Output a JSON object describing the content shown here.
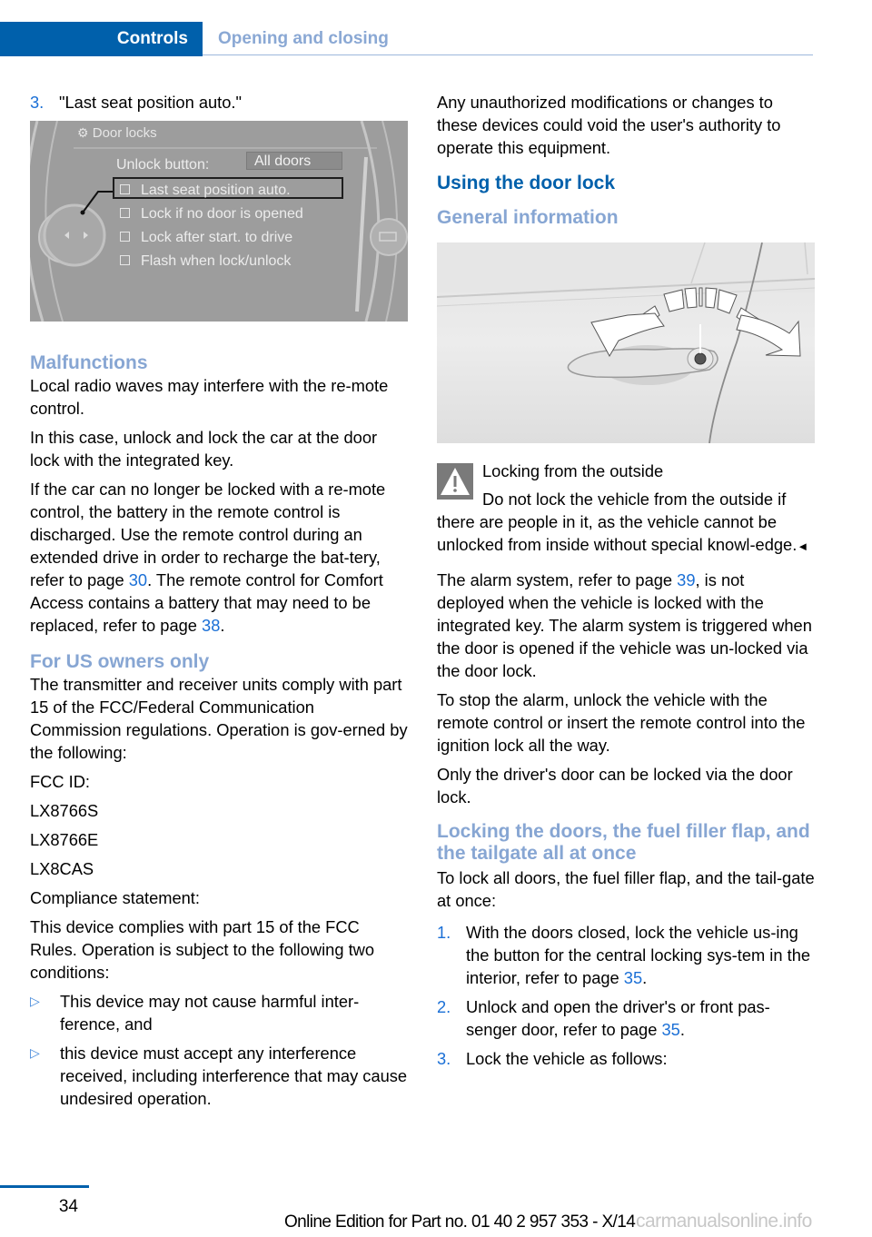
{
  "header": {
    "section": "Controls",
    "subsection": "Opening and closing"
  },
  "left": {
    "step3": {
      "num": "3.",
      "text": "\"Last seat position auto.\""
    },
    "screen": {
      "title": "Door locks",
      "unlock_label": "Unlock button:",
      "unlock_value": "All doors",
      "options": [
        {
          "label": "Last seat position auto.",
          "checked": false,
          "selected": true
        },
        {
          "label": "Lock if no door is opened",
          "checked": false,
          "selected": false
        },
        {
          "label": "Lock after start. to drive",
          "checked": false,
          "selected": false
        },
        {
          "label": "Flash when lock/unlock",
          "checked": false,
          "selected": false
        }
      ]
    },
    "malfunctions": {
      "heading": "Malfunctions",
      "p1": "Local radio waves may interfere with the re-mote control.",
      "p2": "In this case, unlock and lock the car at the door lock with the integrated key.",
      "p3a": "If the car can no longer be locked with a re-mote control, the battery in the remote control is discharged. Use the remote control during an extended drive in order to recharge the bat-tery, refer to page ",
      "p3_link1": "30",
      "p3b": ". The remote control for Comfort Access contains a battery that may need to be replaced, refer to page ",
      "p3_link2": "38",
      "p3c": "."
    },
    "us_owners": {
      "heading": "For US owners only",
      "p1": "The transmitter and receiver units comply with part 15 of the FCC/Federal Communication Commission regulations. Operation is gov-erned by the following:",
      "fcc_label": "FCC ID:",
      "ids": [
        "LX8766S",
        "LX8766E",
        "LX8CAS"
      ],
      "compliance_label": "Compliance statement:",
      "p2": "This device complies with part 15 of the FCC Rules. Operation is subject to the following two conditions:",
      "bullet_glyph": "▷",
      "conditions": [
        "This device may not cause harmful inter-ference, and",
        "this device must accept any interference received, including interference that may cause undesired operation."
      ]
    }
  },
  "right": {
    "p_unauth": "Any unauthorized modifications or changes to these devices could void the user's authority to operate this equipment.",
    "heading_door_lock": "Using the door lock",
    "heading_general": "General information",
    "warning": {
      "title": "Locking from the outside",
      "text": "Do not lock the vehicle from the outside if there are people in it, as the vehicle cannot be unlocked from inside without special knowl-edge.",
      "end_mark": "◄"
    },
    "alarm": {
      "a": "The alarm system, refer to page ",
      "link": "39",
      "b": ", is not deployed when the vehicle is locked with the integrated key. The alarm system is triggered when the door is opened if the vehicle was un-locked via the door lock."
    },
    "stop_alarm": "To stop the alarm, unlock the vehicle with the remote control or insert the remote control into the ignition lock all the way.",
    "driver_only": "Only the driver's door can be locked via the door lock.",
    "heading_lock_all": "Locking the doors, the fuel filler flap, and the tailgate all at once",
    "lock_all_intro": "To lock all doors, the fuel filler flap, and the tail-gate at once:",
    "steps": [
      {
        "num": "1.",
        "text": "With the doors closed, lock the vehicle us-ing the button for the central locking sys-tem in the interior, refer to page ",
        "link": "35",
        "tail": "."
      },
      {
        "num": "2.",
        "text": "Unlock and open the driver's or front pas-senger door, refer to page ",
        "link": "35",
        "tail": "."
      },
      {
        "num": "3.",
        "text": "Lock the vehicle as follows:",
        "link": "",
        "tail": ""
      }
    ]
  },
  "footer": {
    "page_number": "34",
    "edition": "Online Edition for Part no. 01 40 2 957 353 - X/14",
    "watermark": "carmanualsonline.info"
  },
  "colors": {
    "brand_blue": "#0060ab",
    "light_heading": "#87a6d3",
    "link_blue": "#1a6fd6"
  }
}
